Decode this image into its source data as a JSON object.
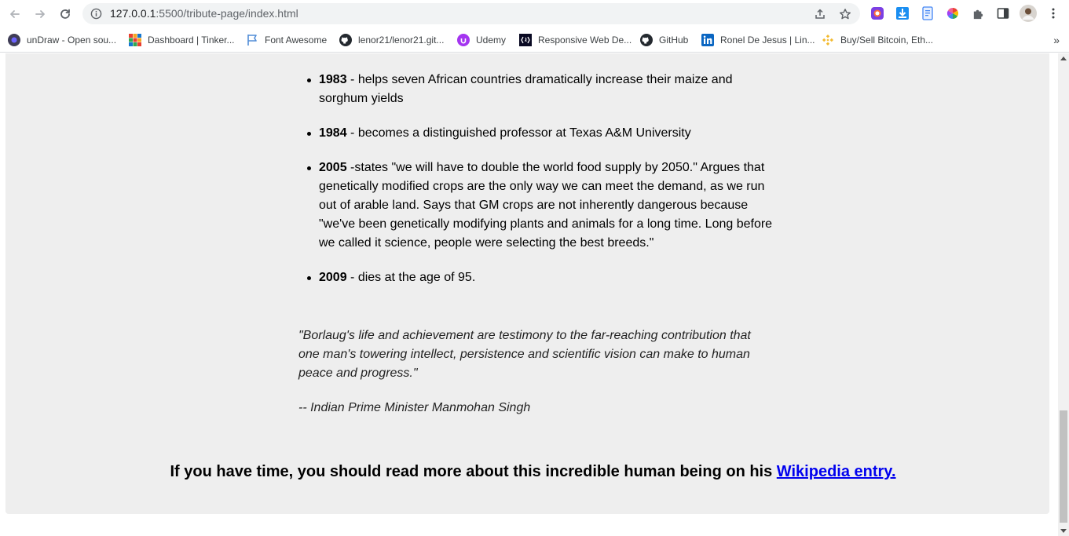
{
  "browser": {
    "url_host": "127.0.0.1",
    "url_path": ":5500/tribute-page/index.html",
    "bookmarks": [
      {
        "label": "unDraw - Open sou...",
        "icon": "undraw-icon"
      },
      {
        "label": "Dashboard | Tinker...",
        "icon": "tinkercad-icon"
      },
      {
        "label": "Font Awesome",
        "icon": "flag-icon"
      },
      {
        "label": "lenor21/lenor21.git...",
        "icon": "github-icon"
      },
      {
        "label": "Udemy",
        "icon": "udemy-icon"
      },
      {
        "label": "Responsive Web De...",
        "icon": "fcc-icon"
      },
      {
        "label": "GitHub",
        "icon": "github-icon"
      },
      {
        "label": "Ronel De Jesus | Lin...",
        "icon": "linkedin-icon"
      },
      {
        "label": "Buy/Sell Bitcoin, Eth...",
        "icon": "binance-icon"
      }
    ],
    "more": "»"
  },
  "timeline": [
    {
      "year": "1983",
      "text": " - helps seven African countries dramatically increase their maize and sorghum yields"
    },
    {
      "year": "1984",
      "text": " - becomes a distinguished professor at Texas A&M University"
    },
    {
      "year": "2005",
      "text": " -states \"we will have to double the world food supply by 2050.\" Argues that genetically modified crops are the only way we can meet the demand, as we run out of arable land. Says that GM crops are not inherently dangerous because \"we've been genetically modifying plants and animals for a long time. Long before we called it science, people were selecting the best breeds.\""
    },
    {
      "year": "2009",
      "text": " - dies at the age of 95."
    }
  ],
  "quote": {
    "text": "\"Borlaug's life and achievement are testimony to the far-reaching contribution that one man's towering intellect, persistence and scientific vision can make to human peace and progress.\"",
    "author": "-- Indian Prime Minister Manmohan Singh"
  },
  "footer": {
    "text": "If you have time, you should read more about this incredible human being on his ",
    "link": "Wikipedia entry."
  }
}
